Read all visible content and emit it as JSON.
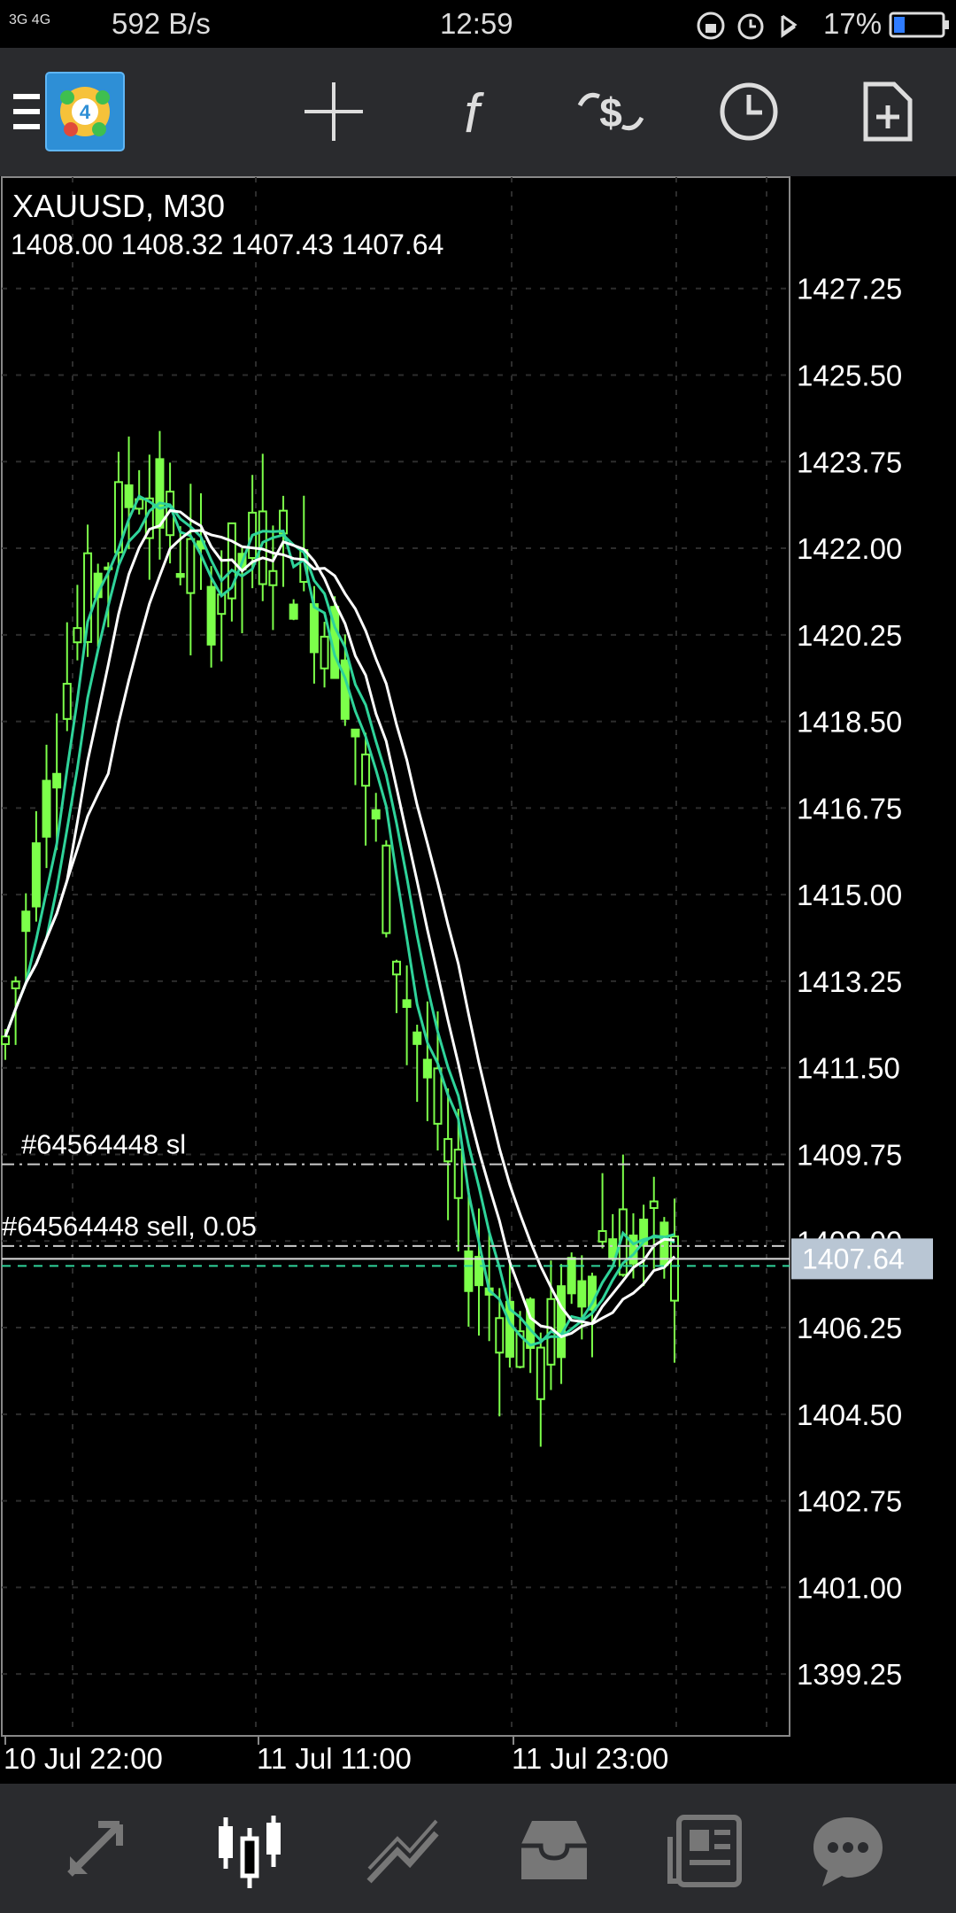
{
  "status_bar": {
    "network": "3G 4G",
    "speed": "592 B/s",
    "time": "12:59",
    "battery": "17%"
  },
  "toolbar": {
    "icons": [
      "menu-icon",
      "metatrader-logo-icon",
      "crosshair-icon",
      "indicators-icon",
      "trade-icon",
      "period-clock-icon",
      "new-order-icon"
    ]
  },
  "chart": {
    "symbol": "XAUUSD, M30",
    "ohlc": "1408.00 1408.32 1407.43 1407.64",
    "price_axis": [
      "1427.25",
      "1425.50",
      "1423.75",
      "1422.00",
      "1420.25",
      "1418.50",
      "1416.75",
      "1415.00",
      "1413.25",
      "1411.50",
      "1409.75",
      "1408.00",
      "1406.25",
      "1404.50",
      "1402.75",
      "1401.00",
      "1399.25"
    ],
    "time_axis": [
      "10 Jul 22:00",
      "11 Jul 11:00",
      "11 Jul 23:00"
    ],
    "current_price": "1407.64",
    "sl_label": "#64564448 sl",
    "order_label": "#64564448 sell, 0.05",
    "colors": {
      "bull": "#7cff4a",
      "ma_green": "#2fd39a",
      "ma_white": "#ffffff",
      "bg": "#000000",
      "grid": "#2d2d2d"
    }
  },
  "chart_data": {
    "type": "line",
    "title": "XAUUSD, M30",
    "x": [
      "10 Jul 22:00",
      "11 Jul 11:00",
      "11 Jul 23:00"
    ],
    "ylim": [
      1398.0,
      1429.5
    ],
    "series": [
      {
        "values": [
          1412.0,
          1420.0,
          1423.6,
          1421.0,
          1422.3,
          1420.0,
          1413.0,
          1407.5,
          1405.5,
          1408.3,
          1407.6
        ]
      }
    ],
    "levels": {
      "sl": 1409.55,
      "order": 1407.9,
      "current": 1407.64
    }
  },
  "bottom_nav": {
    "items": [
      "quotes-icon",
      "chart-icon",
      "trade-icon",
      "history-icon",
      "news-icon",
      "chat-icon"
    ]
  }
}
